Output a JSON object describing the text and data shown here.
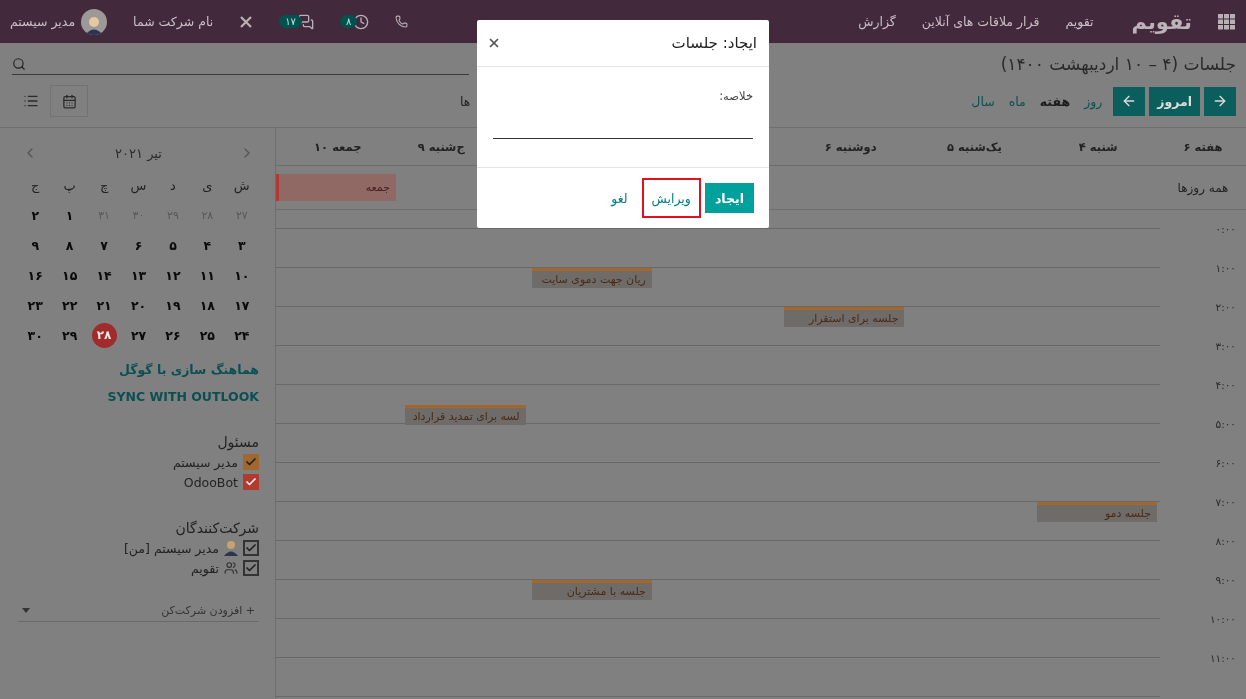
{
  "navbar": {
    "brand": "تقویم",
    "menu": [
      {
        "label": "تقویم"
      },
      {
        "label": "قرار ملاقات های آنلاین"
      },
      {
        "label": "گزارش"
      }
    ],
    "activity_count": "۸",
    "message_count": "۱۷",
    "company": "نام شرکت شما",
    "user": "مدیر سیستم"
  },
  "control_panel": {
    "title": "جلسات (۴ – ۱۰ اردیبهشت ۱۴۰۰)",
    "today": "امروز",
    "scales": [
      {
        "label": "روز",
        "selected": false
      },
      {
        "label": "هفته",
        "selected": true
      },
      {
        "label": "ماه",
        "selected": false
      },
      {
        "label": "سال",
        "selected": false
      }
    ],
    "options_fragment": "ها",
    "views": [
      {
        "kind": "calendar",
        "selected": true
      },
      {
        "kind": "list",
        "selected": false
      }
    ]
  },
  "sidebar": {
    "month": "تیر ۲۰۲۱",
    "weekdays": [
      "ش",
      "ی",
      "د",
      "س",
      "چ",
      "پ",
      "ج"
    ],
    "weeks": [
      [
        {
          "label": "۲۷",
          "other_month": true,
          "today": false
        },
        {
          "label": "۲۸",
          "other_month": true,
          "today": false
        },
        {
          "label": "۲۹",
          "other_month": true,
          "today": false
        },
        {
          "label": "۳۰",
          "other_month": true,
          "today": false
        },
        {
          "label": "۳۱",
          "other_month": true,
          "today": false
        },
        {
          "label": "۱",
          "other_month": false,
          "today": false
        },
        {
          "label": "۲",
          "other_month": false,
          "today": false
        }
      ],
      [
        {
          "label": "۳",
          "other_month": false,
          "today": false
        },
        {
          "label": "۴",
          "other_month": false,
          "today": false
        },
        {
          "label": "۵",
          "other_month": false,
          "today": false
        },
        {
          "label": "۶",
          "other_month": false,
          "today": false
        },
        {
          "label": "۷",
          "other_month": false,
          "today": false
        },
        {
          "label": "۸",
          "other_month": false,
          "today": false
        },
        {
          "label": "۹",
          "other_month": false,
          "today": false
        }
      ],
      [
        {
          "label": "۱۰",
          "other_month": false,
          "today": false
        },
        {
          "label": "۱۱",
          "other_month": false,
          "today": false
        },
        {
          "label": "۱۲",
          "other_month": false,
          "today": false
        },
        {
          "label": "۱۳",
          "other_month": false,
          "today": false
        },
        {
          "label": "۱۴",
          "other_month": false,
          "today": false
        },
        {
          "label": "۱۵",
          "other_month": false,
          "today": false
        },
        {
          "label": "۱۶",
          "other_month": false,
          "today": false
        }
      ],
      [
        {
          "label": "۱۷",
          "other_month": false,
          "today": false
        },
        {
          "label": "۱۸",
          "other_month": false,
          "today": false
        },
        {
          "label": "۱۹",
          "other_month": false,
          "today": false
        },
        {
          "label": "۲۰",
          "other_month": false,
          "today": false
        },
        {
          "label": "۲۱",
          "other_month": false,
          "today": false
        },
        {
          "label": "۲۲",
          "other_month": false,
          "today": false
        },
        {
          "label": "۲۳",
          "other_month": false,
          "today": false
        }
      ],
      [
        {
          "label": "۲۴",
          "other_month": false,
          "today": false
        },
        {
          "label": "۲۵",
          "other_month": false,
          "today": false
        },
        {
          "label": "۲۶",
          "other_month": false,
          "today": false
        },
        {
          "label": "۲۷",
          "other_month": false,
          "today": false
        },
        {
          "label": "۲۸",
          "other_month": false,
          "today": true
        },
        {
          "label": "۲۹",
          "other_month": false,
          "today": false
        },
        {
          "label": "۳۰",
          "other_month": false,
          "today": false
        }
      ]
    ],
    "sync_links": [
      "هماهنگ سازی با گوگل",
      "SYNC WITH OUTLOOK"
    ],
    "filters": [
      {
        "title": "مسئول",
        "items": [
          {
            "label": "مدیر سیستم",
            "checked": true,
            "kind": "colored",
            "color": "#a2662f"
          },
          {
            "label": "OdooBot",
            "checked": true,
            "kind": "colored",
            "color": "#b23b31"
          }
        ]
      },
      {
        "title": "شرکت‌کنندگان",
        "items": [
          {
            "label": "مدیر سیستم [من]",
            "checked": true,
            "kind": "person"
          },
          {
            "label": "تقویم",
            "checked": true,
            "kind": "group"
          }
        ]
      }
    ],
    "add_attendee_placeholder": "+ افزودن شرکت‌کن"
  },
  "calendar": {
    "week_label": "هفته ۶",
    "all_day_label": "همه روزها",
    "hours": [
      "۰:۰۰",
      "۱:۰۰",
      "۲:۰۰",
      "۳:۰۰",
      "۴:۰۰",
      "۵:۰۰",
      "۶:۰۰",
      "۷:۰۰",
      "۸:۰۰",
      "۹:۰۰",
      "۱۰:۰۰",
      "۱۱:۰۰"
    ],
    "days": [
      {
        "kind": "day",
        "label": "شنبه ۴",
        "events": [
          {
            "title": "جلسه دمو",
            "color": "#a2662f"
          }
        ]
      },
      {
        "kind": "day",
        "label": "یک‌شنبه ۵"
      },
      {
        "kind": "day",
        "label": "دوشنبه ۶",
        "events": [
          {
            "title": "جلسه برای استقرار",
            "color": "#a2662f"
          }
        ]
      },
      {
        "kind": "day"
      },
      {
        "kind": "day",
        "events": [
          {
            "title": "ریان جهت دموی سایت",
            "color": "#a2662f"
          },
          {
            "title": "جلسه با مشتریان",
            "color": "#a2662f"
          }
        ]
      },
      {
        "kind": "day",
        "label": "ج‌شنبه ۹",
        "events": [
          {
            "title": "لسه برای تمدید قرارداد",
            "color": "#a2662f"
          }
        ]
      },
      {
        "kind": "day",
        "label": "جمعه ۱۰",
        "all_day": [
          {
            "title": "جمعه",
            "color": "#b23b31"
          }
        ]
      }
    ]
  },
  "dialog": {
    "title": "ایجاد: جلسات",
    "field_label": "خلاصه:",
    "buttons": [
      {
        "label": "ایجاد",
        "kind": "primary",
        "highlighted": false
      },
      {
        "label": "ویرایش",
        "kind": "link",
        "highlighted": true
      },
      {
        "label": "لغو",
        "kind": "link",
        "highlighted": false
      }
    ]
  }
}
